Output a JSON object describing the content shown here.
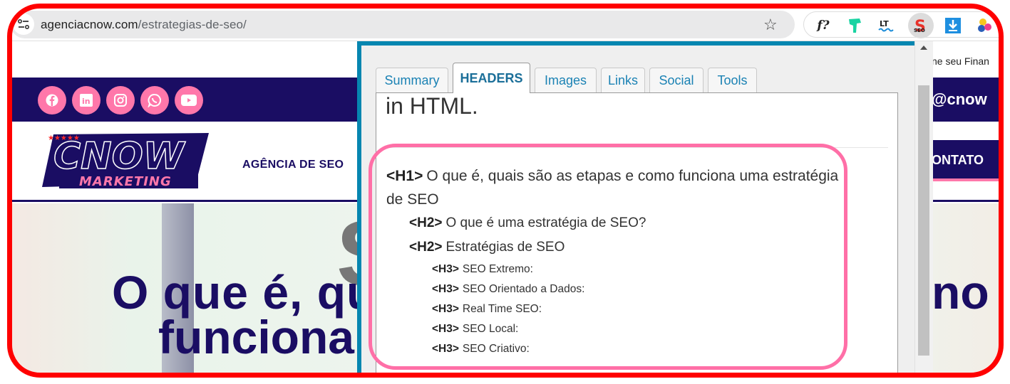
{
  "browser": {
    "url_domain": "agenciacnow.com",
    "url_path": "/estrategias-de-seo/",
    "icons": [
      "site-info-icon",
      "bookmark-star-icon"
    ],
    "extensions": [
      {
        "name": "font-identifier-extension",
        "label": "f?"
      },
      {
        "name": "green-creature-extension",
        "label": ""
      },
      {
        "name": "languagetool-extension",
        "label": "LT"
      },
      {
        "name": "seo-extension",
        "label": "SEO"
      },
      {
        "name": "download-extension",
        "label": ""
      },
      {
        "name": "color-extension",
        "label": ""
      }
    ]
  },
  "website": {
    "topbar_text": "ne seu Finan",
    "social_icons": [
      "facebook",
      "linkedin",
      "instagram",
      "whatsapp",
      "youtube"
    ],
    "handle": "@cnow",
    "logo_main": "CNOW",
    "logo_sub": "MARKETING",
    "nav_item": "AGÊNCIA DE SEO",
    "contact_button": "ONTATO",
    "hero_line1_left": "O que é, qu",
    "hero_line1_right": "no",
    "hero_line2": "funciona",
    "colors": {
      "navy": "#1a0d63",
      "pink": "#ff77aa"
    }
  },
  "seo_popup": {
    "tabs": [
      {
        "label": "Summary",
        "active": false
      },
      {
        "label": "HEADERS",
        "active": true
      },
      {
        "label": "Images",
        "active": false
      },
      {
        "label": "Links",
        "active": false
      },
      {
        "label": "Social",
        "active": false
      },
      {
        "label": "Tools",
        "active": false
      }
    ],
    "intro_text": "in HTML.",
    "headers": [
      {
        "level": "H1",
        "tag": "<H1>",
        "text": "O que é, quais são as etapas e como funciona uma estratégia de SEO"
      },
      {
        "level": "H2",
        "tag": "<H2>",
        "text": "O que é uma estratégia de SEO?"
      },
      {
        "level": "H2",
        "tag": "<H2>",
        "text": "Estratégias de SEO"
      },
      {
        "level": "H3",
        "tag": "<H3>",
        "text": "SEO Extremo:"
      },
      {
        "level": "H3",
        "tag": "<H3>",
        "text": "SEO Orientado a Dados:"
      },
      {
        "level": "H3",
        "tag": "<H3>",
        "text": "Real Time SEO:"
      },
      {
        "level": "H3",
        "tag": "<H3>",
        "text": "SEO Local:"
      },
      {
        "level": "H3",
        "tag": "<H3>",
        "text": "SEO Criativo:"
      }
    ],
    "colors": {
      "border": "#0686b0",
      "highlight": "#ff6fa7",
      "tab_text": "#1b82b4"
    }
  },
  "annotation": {
    "frame_color": "#ff0000"
  }
}
